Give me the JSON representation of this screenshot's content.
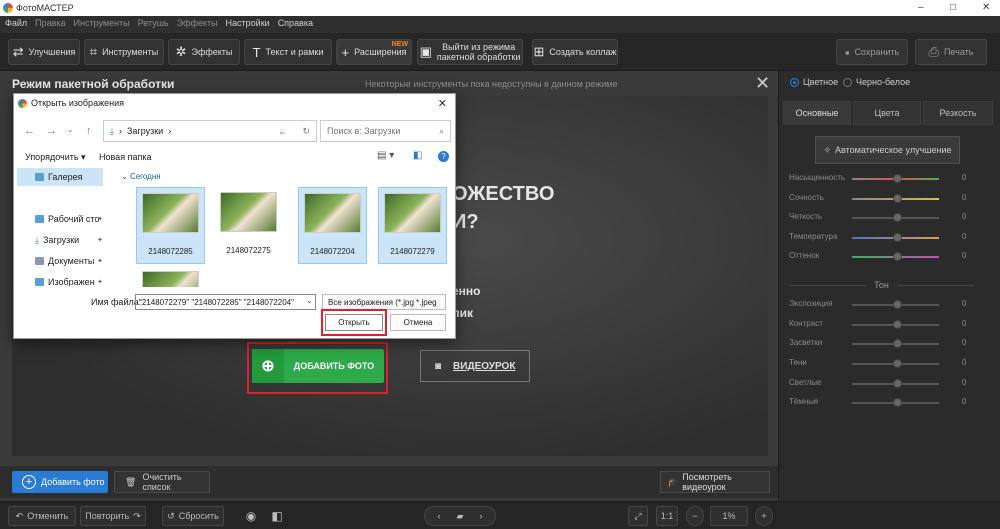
{
  "app": {
    "title": "ФотоМАСТЕР",
    "window_controls": [
      "–",
      "□",
      "✕"
    ]
  },
  "menu": [
    "Файл",
    "Правка",
    "Инструменты",
    "Ретушь",
    "Эффекты",
    "Настройки",
    "Справка"
  ],
  "toolbar": {
    "enhance": "Улучшения",
    "tools": "Инструменты",
    "effects": "Эффекты",
    "text_frames": "Текст и рамки",
    "extensions": "Расширения",
    "new_badge": "NEW",
    "exit_batch_l1": "Выйти из режима",
    "exit_batch_l2": "пакетной обработки",
    "collage": "Создать коллаж",
    "save": "Сохранить",
    "print": "Печать"
  },
  "panel": {
    "title": "Режим пакетной обработки",
    "note": "Некоторые инструменты пока недоступны в данном режиме",
    "close": "✕",
    "hero_l1": "ОЖЕСТВО",
    "hero_l2": "И?",
    "hero_l3": "енно",
    "hero_l4": "лик",
    "add_photo_center": "ДОБАВИТЬ ФОТО",
    "video_lesson": "ВИДЕОУРОК"
  },
  "bottom": {
    "add_photo": "Добавить фото",
    "clear_list": "Очистить список",
    "watch_video": "Посмотреть видеоурок",
    "undo": "Отменить",
    "redo": "Повторить",
    "reset": "Сбросить",
    "ratio": "1:1",
    "zoom": "1%"
  },
  "right_panel": {
    "color_mode": "Цветное",
    "bw_mode": "Черно-белое",
    "tabs": [
      "Основные",
      "Цвета",
      "Резкость"
    ],
    "auto_enhance": "Автоматическое улучшение",
    "sliders": [
      {
        "name": "Насыщенность",
        "value": "0"
      },
      {
        "name": "Сочность",
        "value": "0"
      },
      {
        "name": "Четкость",
        "value": "0"
      },
      {
        "name": "Температура",
        "value": "0"
      },
      {
        "name": "Оттенок",
        "value": "0"
      }
    ],
    "tone_label": "Тон",
    "tone_sliders": [
      {
        "name": "Экспозиция",
        "value": "0"
      },
      {
        "name": "Контраст",
        "value": "0"
      },
      {
        "name": "Засветки",
        "value": "0"
      },
      {
        "name": "Тени",
        "value": "0"
      },
      {
        "name": "Светлые",
        "value": "0"
      },
      {
        "name": "Тёмные",
        "value": "0"
      }
    ]
  },
  "dialog": {
    "title": "Открыть изображения",
    "address": "Загрузки",
    "search_placeholder": "Поиск в: Загрузки",
    "organize": "Упорядочить ▾",
    "new_folder": "Новая папка",
    "sidebar": [
      "Галерея",
      "Рабочий сто",
      "Загрузки",
      "Документы",
      "Изображен"
    ],
    "group": "Сегодня",
    "files": [
      "2148072285",
      "2148072275",
      "2148072204",
      "2148072279",
      ""
    ],
    "filename_label": "Имя файла:",
    "filename_value": "\"2148072279\" \"2148072285\" \"2148072204\"",
    "filetype": "Все изображения (*.jpg *.jpeg",
    "open": "Открыть",
    "cancel": "Отмена"
  }
}
